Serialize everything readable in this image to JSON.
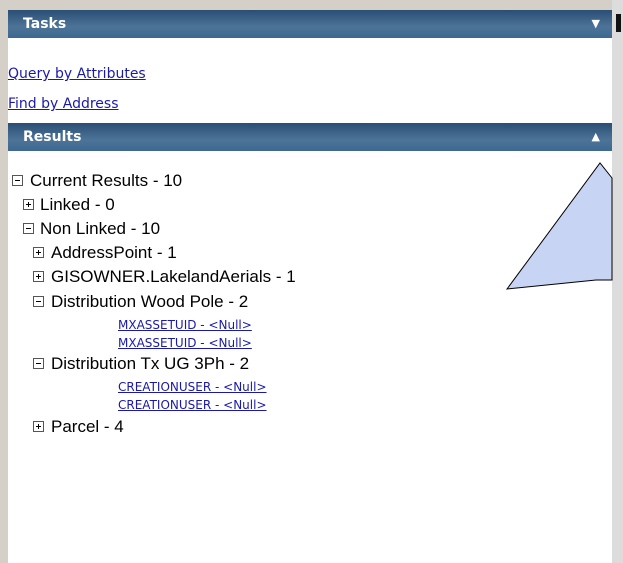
{
  "tasks": {
    "title": "Tasks",
    "links": [
      "Query by Attributes",
      "Find by Address"
    ]
  },
  "results": {
    "title": "Results",
    "current": "Current Results - 10",
    "linked": "Linked - 0",
    "non_linked": "Non Linked - 10",
    "address_point": "AddressPoint - 1",
    "lakeland_aerials": "GISOWNER.LakelandAerials - 1",
    "wood_pole": "Distribution Wood Pole - 2",
    "wood_pole_items": [
      "MXASSETUID - <Null>",
      "MXASSETUID - <Null>"
    ],
    "tx_ug": "Distribution Tx UG 3Ph - 2",
    "tx_ug_items": [
      "CREATIONUSER - <Null>",
      "CREATIONUSER - <Null>"
    ],
    "parcel": "Parcel - 4"
  },
  "colors": {
    "header_bar": "#3e6890",
    "link": "#1a1aa8",
    "callout_fill": "#c8d4f4"
  },
  "icons": {
    "tasks_collapse": "triangle-down-icon",
    "results_collapse": "triangle-up-icon",
    "expand": "plus-box-icon",
    "collapse": "minus-box-icon"
  }
}
